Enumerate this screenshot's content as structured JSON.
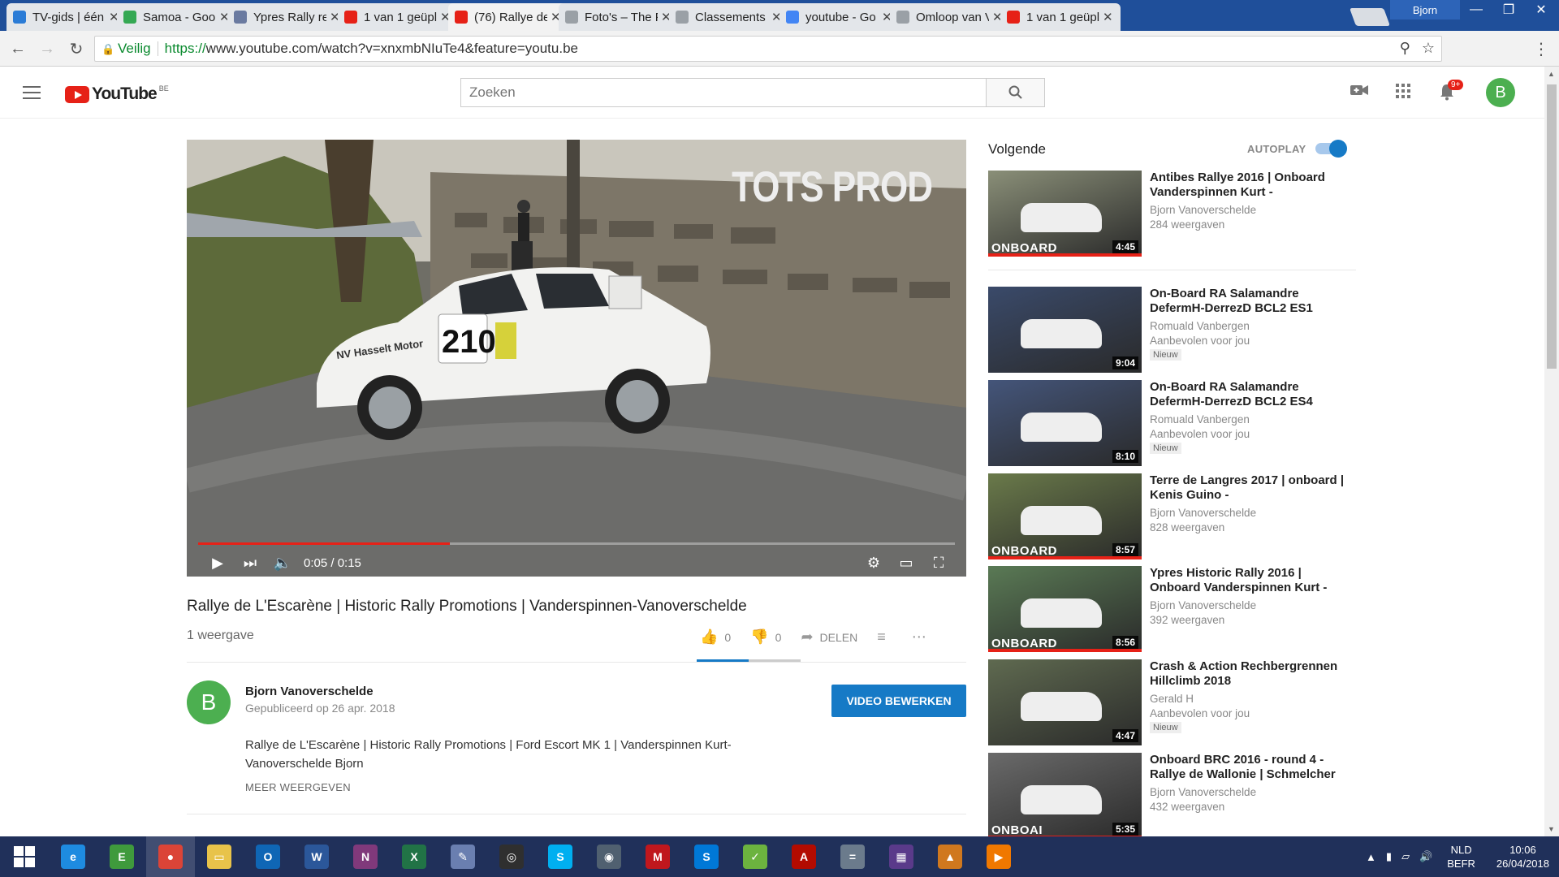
{
  "browser": {
    "tabs": [
      {
        "title": "TV-gids | één",
        "color": "#2a7bd6"
      },
      {
        "title": "Samoa - Goo",
        "color": "#34a853"
      },
      {
        "title": "Ypres Rally re",
        "color": "#6a7aa0"
      },
      {
        "title": "1 van 1 geüpl",
        "color": "#e62117"
      },
      {
        "title": "(76) Rallye de",
        "color": "#e62117"
      },
      {
        "title": "Foto's – The F",
        "color": "#9aa0a6"
      },
      {
        "title": "Classements",
        "color": "#9aa0a6"
      },
      {
        "title": "youtube - Go",
        "color": "#4285f4"
      },
      {
        "title": "Omloop van V",
        "color": "#9aa0a6"
      },
      {
        "title": "1 van 1 geüpl",
        "color": "#e62117"
      }
    ],
    "window_user": "Bjorn",
    "secure_label": "Veilig",
    "url_scheme": "https://",
    "url_rest": "www.youtube.com/watch?v=xnxmbNIuTe4&feature=youtu.be"
  },
  "masthead": {
    "logo_word": "YouTube",
    "country": "BE",
    "search_placeholder": "Zoeken",
    "notif_count": "9+",
    "avatar_letter": "B"
  },
  "player": {
    "watermark": "TOTS PROD",
    "time": "0:05 / 0:15",
    "progress": 0.333
  },
  "video": {
    "title": "Rallye de L'Escarène | Historic Rally Promotions | Vanderspinnen-Vanoverschelde",
    "views": "1 weergave",
    "likes": "0",
    "dislikes": "0",
    "share": "DELEN",
    "channel": "Bjorn Vanoverschelde",
    "channel_letter": "B",
    "published": "Gepubliceerd op 26 apr. 2018",
    "edit_button": "VIDEO BEWERKEN",
    "description": "Rallye de L'Escarène | Historic Rally Promotions | Ford Escort MK 1 | Vanderspinnen Kurt-Vanoverschelde Bjorn",
    "more": "MEER WEERGEVEN"
  },
  "sidebar": {
    "up_next": "Volgende",
    "autoplay": "AUTOPLAY",
    "items": [
      {
        "title": "Antibes Rallye 2016 | Onboard Vanderspinnen Kurt -",
        "channel": "Bjorn Vanoverschelde",
        "views": "284 weergaven",
        "duration": "4:45",
        "badge": "",
        "overlay": "ONBOARD",
        "bg": "#8a8f78"
      },
      {
        "title": "On-Board RA Salamandre DefermH-DerrezD BCL2 ES1",
        "channel": "Romuald Vanbergen",
        "views": "Aanbevolen voor jou",
        "duration": "9:04",
        "badge": "Nieuw",
        "overlay": "",
        "bg": "#3a4a6a"
      },
      {
        "title": "On-Board RA Salamandre DefermH-DerrezD BCL2 ES4",
        "channel": "Romuald Vanbergen",
        "views": "Aanbevolen voor jou",
        "duration": "8:10",
        "badge": "Nieuw",
        "overlay": "",
        "bg": "#44557a"
      },
      {
        "title": "Terre de Langres 2017 | onboard | Kenis Guino -",
        "channel": "Bjorn Vanoverschelde",
        "views": "828 weergaven",
        "duration": "8:57",
        "badge": "",
        "overlay": "ONBOARD",
        "bg": "#6a7a4a"
      },
      {
        "title": "Ypres Historic Rally 2016 | Onboard Vanderspinnen Kurt -",
        "channel": "Bjorn Vanoverschelde",
        "views": "392 weergaven",
        "duration": "8:56",
        "badge": "",
        "overlay": "ONBOARD",
        "bg": "#5a7a55"
      },
      {
        "title": "Crash & Action Rechbergrennen Hillclimb 2018",
        "channel": "Gerald H",
        "views": "Aanbevolen voor jou",
        "duration": "4:47",
        "badge": "Nieuw",
        "overlay": "",
        "bg": "#5f6a50"
      },
      {
        "title": "Onboard BRC 2016 - round 4 - Rallye de Wallonie | Schmelcher",
        "channel": "Bjorn Vanoverschelde",
        "views": "432 weergaven",
        "duration": "5:35",
        "badge": "",
        "overlay": "ONBOAI",
        "bg": "#6a6a6a"
      }
    ]
  },
  "taskbar": {
    "apps": [
      {
        "name": "ie",
        "color": "#1e8be0",
        "glyph": "e"
      },
      {
        "name": "evernote",
        "color": "#3f9a3c",
        "glyph": "E"
      },
      {
        "name": "chrome",
        "color": "#db4437",
        "glyph": "●"
      },
      {
        "name": "explorer",
        "color": "#e8c34a",
        "glyph": "▭"
      },
      {
        "name": "outlook",
        "color": "#0f66b5",
        "glyph": "O"
      },
      {
        "name": "word",
        "color": "#2b579a",
        "glyph": "W"
      },
      {
        "name": "onenote",
        "color": "#80397b",
        "glyph": "N"
      },
      {
        "name": "excel",
        "color": "#217346",
        "glyph": "X"
      },
      {
        "name": "paint",
        "color": "#6a7fb0",
        "glyph": "✎"
      },
      {
        "name": "sync",
        "color": "#2f2f2f",
        "glyph": "◎"
      },
      {
        "name": "skype",
        "color": "#00aff0",
        "glyph": "S"
      },
      {
        "name": "network",
        "color": "#506070",
        "glyph": "◉"
      },
      {
        "name": "mcafee",
        "color": "#c0171d",
        "glyph": "M"
      },
      {
        "name": "skype-business",
        "color": "#0078d7",
        "glyph": "S"
      },
      {
        "name": "notes",
        "color": "#6cb33f",
        "glyph": "✓"
      },
      {
        "name": "acrobat",
        "color": "#b30b00",
        "glyph": "A"
      },
      {
        "name": "calculator",
        "color": "#6b7b8c",
        "glyph": "="
      },
      {
        "name": "color",
        "color": "#5a3a8a",
        "glyph": "▦"
      },
      {
        "name": "files",
        "color": "#d0781e",
        "glyph": "▲"
      },
      {
        "name": "media",
        "color": "#f07800",
        "glyph": "▶"
      }
    ],
    "lang_top": "NLD",
    "lang_bottom": "BEFR",
    "time": "10:06",
    "date": "26/04/2018"
  }
}
